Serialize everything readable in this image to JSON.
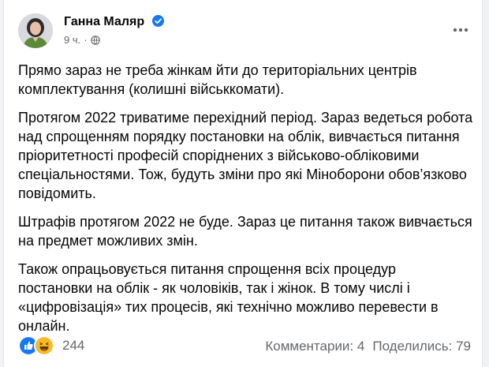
{
  "post": {
    "author": "Ганна Маляр",
    "time": "9 ч.",
    "separator": "·",
    "icons": {
      "avatar": "avatar",
      "verified": "verified-badge-icon",
      "audience": "globe-icon",
      "more": "more-options-icon",
      "like": "like-icon",
      "haha": "haha-icon"
    },
    "paragraphs": [
      "Прямо зараз не треба жінкам йти до територіальних центрів комплектування (колишні військкомати).",
      "Протягом 2022 триватиме перехідний період. Зараз ведеться робота над спрощенням порядку постановки на облік, вивчається питання пріоритетності професій споріднених з військово-обліковими спеціальностями. Тож, будуть зміни про які Міноборони обов’язково повідомить.",
      "Штрафів протягом 2022 не буде. Зараз це питання також вивчається на предмет можливих змін.",
      "Також опрацьовується питання спрощення всіх процедур постановки на облік - як чоловіків, так і жінок. В тому числі і «цифровізація» тих процесів, які технічно можливо перевести в онлайн."
    ],
    "reactions_count": "244",
    "comments": "Комментарии: 4",
    "shares": "Поделились: 79"
  },
  "colors": {
    "like_blue": "#1877f2",
    "haha_yellow": "#f7b928",
    "secondary_text": "#65676b",
    "primary_text": "#050505"
  }
}
